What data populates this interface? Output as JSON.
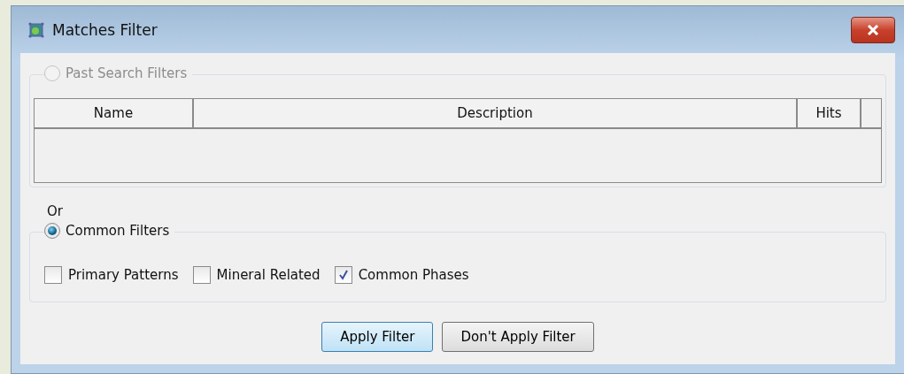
{
  "window": {
    "title": "Matches Filter"
  },
  "past_search_filters": {
    "label": "Past Search Filters",
    "selected": false,
    "disabled": true,
    "table": {
      "columns": [
        "Name",
        "Description",
        "Hits"
      ]
    }
  },
  "separator_label": "Or",
  "common_filters": {
    "label": "Common Filters",
    "selected": true,
    "disabled": false,
    "options": [
      {
        "label": "Primary Patterns",
        "checked": false
      },
      {
        "label": "Mineral Related",
        "checked": false
      },
      {
        "label": "Common Phases",
        "checked": true
      }
    ]
  },
  "buttons": [
    {
      "label": "Apply Filter",
      "default": true
    },
    {
      "label": "Don't Apply Filter",
      "default": false
    }
  ]
}
